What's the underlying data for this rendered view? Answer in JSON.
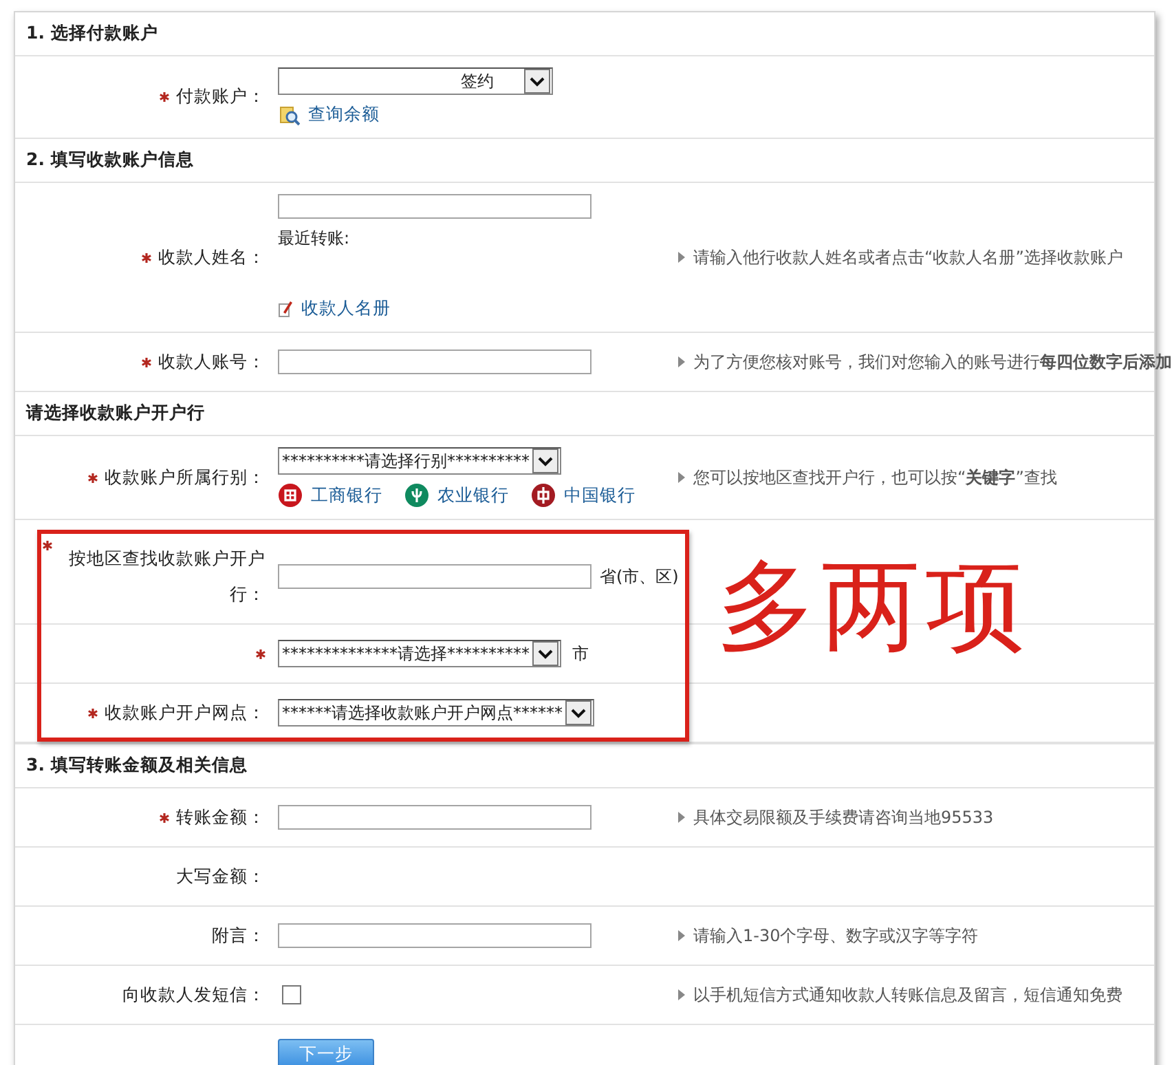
{
  "sections": [
    {
      "title": "1. 选择付款账户",
      "rows": [
        {
          "kind": "select",
          "required": true,
          "label": "付款账户：",
          "value": "签约",
          "links": [
            {
              "text": "查询余额"
            }
          ]
        }
      ]
    },
    {
      "title": "2. 填写收款账户信息",
      "rows": [
        {
          "kind": "text",
          "required": true,
          "label": "收款人姓名：",
          "note": "最近转账:",
          "links": [
            {
              "text": "收款人名册"
            }
          ],
          "hint": "请输入他行收款人姓名或者点击“收款人名册”选择收款账户"
        },
        {
          "kind": "text",
          "required": true,
          "label": "收款人账号：",
          "hint": "为了方便您核对账号，我们对您输入的账号进行**每四位数字后添加**"
        }
      ]
    },
    {
      "title": "请选择收款账户开户行",
      "rows": [
        {
          "kind": "select",
          "required": true,
          "label": "收款账户所属行别：",
          "value": "**********请选择行别**********",
          "banks": [
            {
              "text": "工商银行"
            },
            {
              "text": "农业银行"
            },
            {
              "text": "中国银行"
            }
          ],
          "hint": "您可以按地区查找开户行，也可以按“**关键字**”查找"
        }
      ],
      "annotation": {
        "note": "多两项",
        "rows": [
          {
            "kind": "text",
            "required": true,
            "label": "按地区查找收款账户开户行：",
            "suffix": "省(市、区)"
          },
          {
            "kind": "select",
            "required": true,
            "value": "**************请选择**********",
            "suffix": "市"
          },
          {
            "kind": "select",
            "required": true,
            "label": "收款账户开户网点：",
            "value": "******请选择收款账户开户网点******"
          }
        ]
      }
    },
    {
      "title": "3. 填写转账金额及相关信息",
      "rows": [
        {
          "kind": "text",
          "required": true,
          "label": "转账金额：",
          "hint": "具体交易限额及手续费请咨询当地95533"
        },
        {
          "kind": "static",
          "required": false,
          "label": "大写金额："
        },
        {
          "kind": "text",
          "required": false,
          "label": "附言：",
          "hint": "请输入1-30个字母、数字或汉字等字符"
        },
        {
          "kind": "checkbox",
          "required": false,
          "checked": false,
          "label": "向收款人发短信：",
          "hint": "以手机短信方式通知收款人转账信息及留言，短信通知免费"
        }
      ]
    }
  ],
  "submit": "下一步"
}
